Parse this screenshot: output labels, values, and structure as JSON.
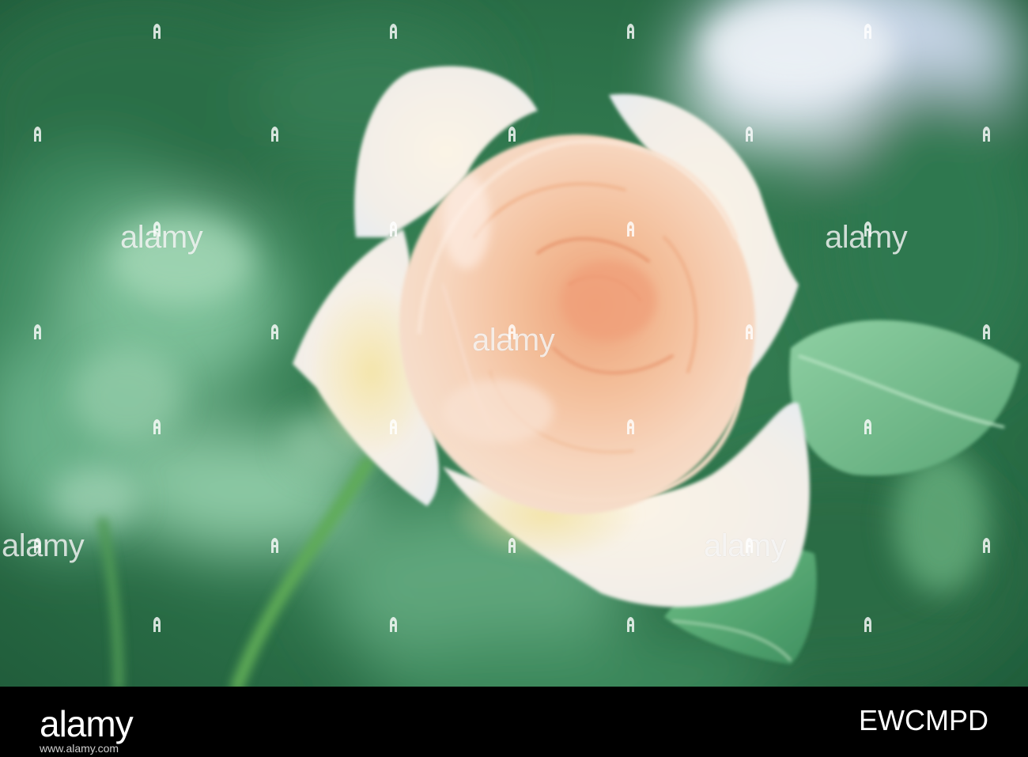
{
  "photo": {
    "subject": "peach-rose-photo",
    "palette": {
      "background_green": "#2f7a4e",
      "light_green": "#7fc39a",
      "petal_cream": "#f6efe6",
      "petal_peach": "#f3c7a2",
      "center_peach": "#eea37c",
      "stem_green": "#4f9a4a"
    }
  },
  "watermark": {
    "text": "alamy",
    "mark_icon": "alamy-a-mark-icon"
  },
  "footer": {
    "logo": "alamy",
    "image_id": "EWCMPD",
    "url": "www.alamy.com"
  }
}
